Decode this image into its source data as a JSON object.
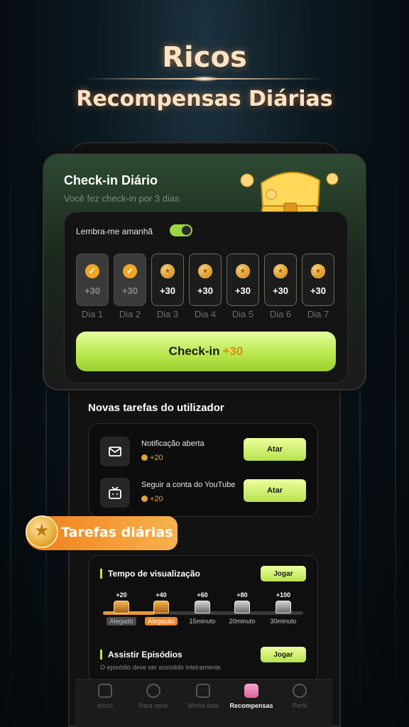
{
  "hero": {
    "title": "Ricos",
    "subtitle": "Recompensas Diárias"
  },
  "checkin": {
    "title": "Check-in Diário",
    "subtitle": "Você fez check-in por 3 dias",
    "remind_label": "Lembra-me amanhã",
    "remind_enabled": true,
    "days": [
      {
        "label": "Dia 1",
        "amount": "+30",
        "claimed": true
      },
      {
        "label": "Dia 2",
        "amount": "+30",
        "claimed": true
      },
      {
        "label": "Dia 3",
        "amount": "+30",
        "claimed": false
      },
      {
        "label": "Dia 4",
        "amount": "+30",
        "claimed": false
      },
      {
        "label": "Dia 5",
        "amount": "+30",
        "claimed": false
      },
      {
        "label": "Dia 6",
        "amount": "+30",
        "claimed": false
      },
      {
        "label": "Dia 7",
        "amount": "+30",
        "claimed": false
      }
    ],
    "button_label": "Check-in",
    "button_bonus": "+30"
  },
  "new_tasks": {
    "title": "Novas tarefas do utilizador",
    "items": [
      {
        "icon": "mail-icon",
        "name": "Notificação aberta",
        "reward": "+20",
        "button": "Atar"
      },
      {
        "icon": "tv-icon",
        "name": "Seguir a conta do YouTube",
        "reward": "+20",
        "button": "Atar"
      }
    ]
  },
  "daily_tasks": {
    "badge": "Tarefas diárias",
    "watch": {
      "title": "Tempo de visualização",
      "button": "Jogar",
      "progress": 0.26,
      "milestones": [
        {
          "value": "+20",
          "label": "Alegado",
          "state": "claimed"
        },
        {
          "value": "+40",
          "label": "Alegação",
          "state": "claimable"
        },
        {
          "value": "+60",
          "label": "15minuto",
          "state": "locked"
        },
        {
          "value": "+80",
          "label": "20minuto",
          "state": "locked"
        },
        {
          "value": "+100",
          "label": "30minuto",
          "state": "locked"
        }
      ]
    },
    "episodes": {
      "title": "Assistir Episódios",
      "button": "Jogar",
      "description": "O episódio deve ser assistido inteiramente."
    }
  },
  "nav": {
    "items": [
      {
        "label": "Início",
        "icon": "home-icon",
        "active": false
      },
      {
        "label": "Para você",
        "icon": "play-icon",
        "active": false
      },
      {
        "label": "Minha lista",
        "icon": "folder-icon",
        "active": false
      },
      {
        "label": "Recompensas",
        "icon": "gift-icon",
        "active": true
      },
      {
        "label": "Perfil",
        "icon": "profile-icon",
        "active": false
      }
    ]
  },
  "colors": {
    "accent_green": "#b7e64a",
    "accent_orange": "#f0862a",
    "coin_gold": "#e0a23b"
  }
}
